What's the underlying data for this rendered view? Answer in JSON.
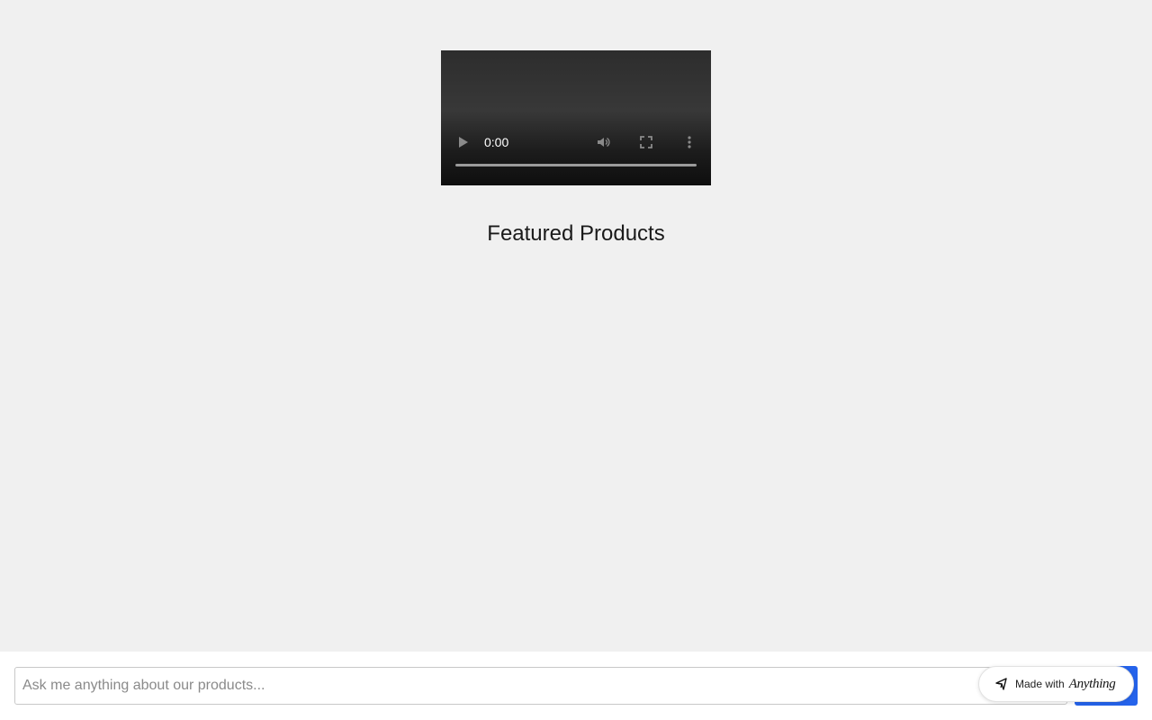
{
  "video": {
    "time": "0:00",
    "progress": 0,
    "icons": [
      "play-icon",
      "volume-icon",
      "fullscreen-icon",
      "more-options-icon"
    ]
  },
  "section": {
    "title": "Featured Products"
  },
  "chat": {
    "placeholder": "Ask me anything about our products...",
    "value": "",
    "send_label": ""
  },
  "badge": {
    "text": "Made with",
    "brand": "Anything"
  },
  "colors": {
    "background": "#f0f0f0",
    "accent": "#2563eb"
  }
}
